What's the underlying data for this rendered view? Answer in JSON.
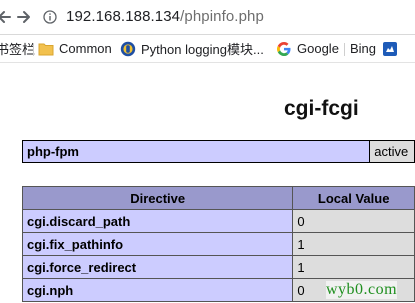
{
  "browser": {
    "url_host": "192.168.188.134",
    "url_path": "/phpinfo.php"
  },
  "bookmarks": {
    "items": [
      {
        "label": "书签栏",
        "icon": "none"
      },
      {
        "label": "Common",
        "icon": "folder-icon"
      },
      {
        "label": "Python logging模块...",
        "icon": "site-favicon-icon"
      },
      {
        "label": "Google",
        "icon": "google-icon"
      },
      {
        "label": "Bing",
        "icon": "bing-icon"
      }
    ]
  },
  "page": {
    "title": "cgi-fcgi",
    "info_table": {
      "label": "php-fpm",
      "value": "active"
    },
    "directive_table": {
      "headers": [
        "Directive",
        "Local Value"
      ],
      "rows": [
        {
          "directive": "cgi.discard_path",
          "local": "0"
        },
        {
          "directive": "cgi.fix_pathinfo",
          "local": "1"
        },
        {
          "directive": "cgi.force_redirect",
          "local": "1"
        },
        {
          "directive": "cgi.nph",
          "local": "0"
        }
      ]
    },
    "watermark": "wyb0.com"
  },
  "colors": {
    "entry_bg": "#ccccff",
    "header_bg": "#9999cc",
    "value_bg": "#dddddd"
  }
}
